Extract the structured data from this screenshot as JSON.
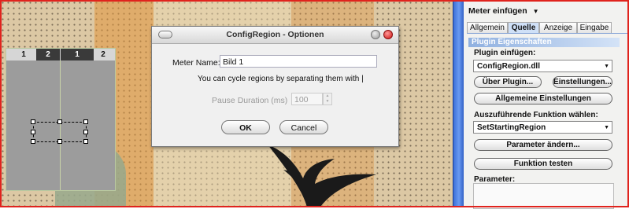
{
  "dialog": {
    "title": "ConfigRegion - Optionen",
    "meter_name_label": "Meter Name:",
    "meter_name_value": "Bild 1",
    "cycle_hint": "You can cycle regions by separating them with |",
    "pause_label": "Pause Duration (ms)",
    "pause_value": "100",
    "ok_label": "OK",
    "cancel_label": "Cancel"
  },
  "preview": {
    "header_numbers": [
      "1",
      "2",
      "1",
      "2"
    ]
  },
  "panel": {
    "title": "Meter einfügen",
    "title_arrow": "▼",
    "tabs": [
      {
        "label": "Allgemein"
      },
      {
        "label": "Quelle"
      },
      {
        "label": "Anzeige"
      },
      {
        "label": "Eingabe"
      }
    ],
    "active_tab": "Quelle",
    "section_title": "Plugin Eigenschaften",
    "plugin_label": "Plugin einfügen:",
    "plugin_value": "ConfigRegion.dll",
    "about_button": "Über Plugin...",
    "settings_button": "Einstellungen...",
    "general_settings_button": "Allgemeine Einstellungen",
    "function_label": "Auszuführende Funktion wählen:",
    "function_value": "SetStartingRegion",
    "change_params_button": "Parameter ändern...",
    "test_function_button": "Funktion testen",
    "parameters_label": "Parameter:"
  },
  "colors": {
    "frame": "#e0231d",
    "canvas": "#dcc8a4",
    "accent": "#3b6fd8"
  }
}
